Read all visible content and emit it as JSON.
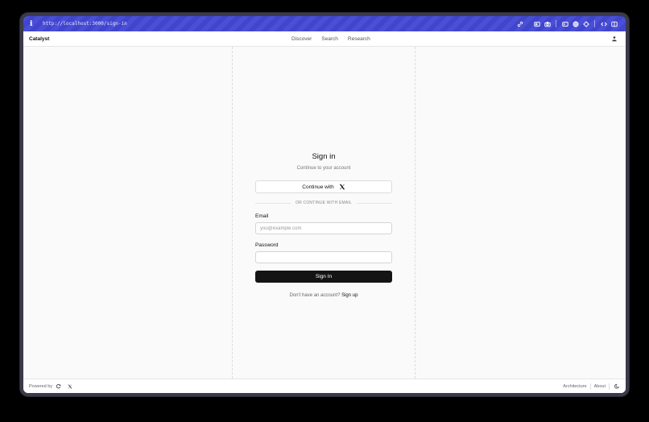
{
  "browser": {
    "info_glyph": "i",
    "url": "http://localhost:3000/sign-in",
    "tools": [
      "link-icon",
      "id-card-icon",
      "camera-icon",
      "terminal-icon",
      "globe-icon",
      "crosshair-icon",
      "code-icon",
      "sidebar-icon"
    ],
    "accent_color": "#4a4fd8"
  },
  "nav": {
    "brand": "Catalyst",
    "links": [
      "Discover",
      "Search",
      "Research"
    ]
  },
  "signin": {
    "title": "Sign in",
    "subtitle": "Continue to your account",
    "x_button": "Continue with",
    "divider": "OR CONTINUE WITH EMAIL",
    "email_label": "Email",
    "email_placeholder": "you@example.com",
    "password_label": "Password",
    "password_placeholder": "",
    "submit": "Sign In",
    "signup_prompt": "Don't have an account?",
    "signup_link": "Sign up"
  },
  "footer": {
    "powered_by": "Powered by",
    "links": [
      "Architecture",
      "About"
    ]
  }
}
